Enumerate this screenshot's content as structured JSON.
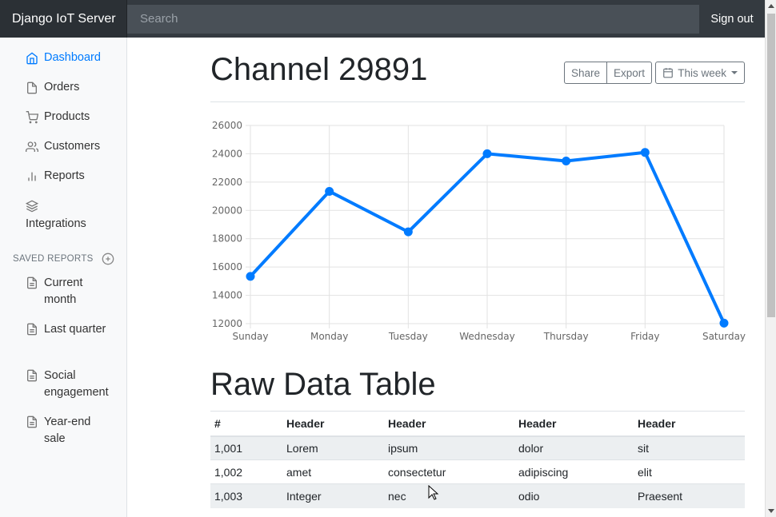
{
  "topbar": {
    "brand": "Django IoT Server",
    "search_placeholder": "Search",
    "signout": "Sign out"
  },
  "sidebar": {
    "nav": [
      {
        "label": "Dashboard",
        "icon": "home-icon",
        "active": true
      },
      {
        "label": "Orders",
        "icon": "file-icon"
      },
      {
        "label": "Products",
        "icon": "cart-icon"
      },
      {
        "label": "Customers",
        "icon": "users-icon"
      },
      {
        "label": "Reports",
        "icon": "bar-chart-icon"
      },
      {
        "label": "Integrations",
        "icon": "layers-icon"
      }
    ],
    "saved_heading": "SAVED REPORTS",
    "saved": [
      {
        "label": "Current month",
        "icon": "file-text-icon"
      },
      {
        "label": "Last quarter",
        "icon": "file-text-icon"
      },
      {
        "label": "Social engagement",
        "icon": "file-text-icon"
      },
      {
        "label": "Year-end sale",
        "icon": "file-text-icon"
      }
    ]
  },
  "main": {
    "title": "Channel 29891",
    "share": "Share",
    "export": "Export",
    "range": "This week",
    "table_title": "Raw Data Table"
  },
  "chart_data": {
    "type": "line",
    "categories": [
      "Sunday",
      "Monday",
      "Tuesday",
      "Wednesday",
      "Thursday",
      "Friday",
      "Saturday"
    ],
    "values": [
      15339,
      21345,
      18483,
      24003,
      23489,
      24092,
      12034
    ],
    "ylim": [
      12000,
      26000
    ],
    "yticks": [
      12000,
      14000,
      16000,
      18000,
      20000,
      22000,
      24000,
      26000
    ],
    "grid": true,
    "color": "#007bff"
  },
  "table": {
    "headers": [
      "#",
      "Header",
      "Header",
      "Header",
      "Header"
    ],
    "rows": [
      [
        "1,001",
        "Lorem",
        "ipsum",
        "dolor",
        "sit"
      ],
      [
        "1,002",
        "amet",
        "consectetur",
        "adipiscing",
        "elit"
      ],
      [
        "1,003",
        "Integer",
        "nec",
        "odio",
        "Praesent"
      ]
    ]
  },
  "colors": {
    "accent": "#007bff",
    "topbar": "#343a40",
    "sidebar": "#f8f9fa"
  }
}
